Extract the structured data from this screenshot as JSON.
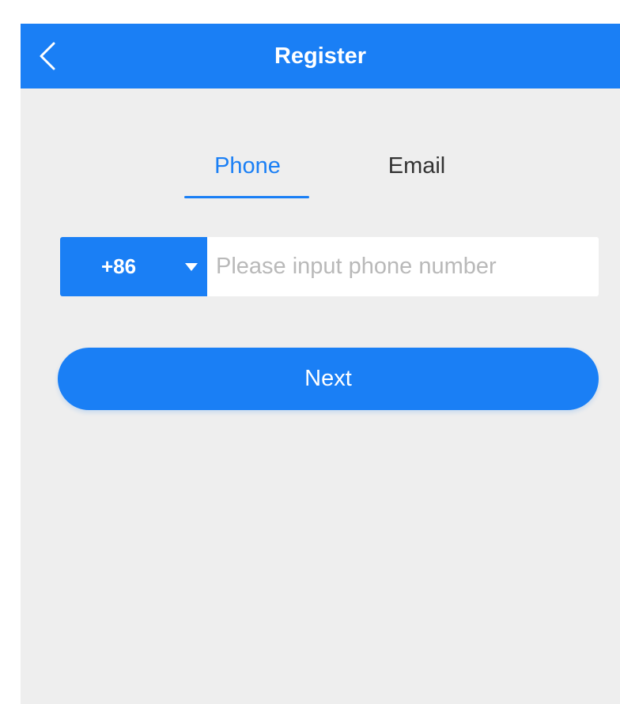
{
  "header": {
    "title": "Register",
    "back_icon": "chevron-left-icon"
  },
  "tabs": [
    {
      "label": "Phone",
      "active": true
    },
    {
      "label": "Email",
      "active": false
    }
  ],
  "phone_form": {
    "country_code": "+86",
    "dropdown_icon": "caret-down-icon",
    "phone_value": "",
    "phone_placeholder": "Please input phone number"
  },
  "actions": {
    "next_label": "Next"
  },
  "colors": {
    "primary": "#1a7ff5",
    "background": "#eeeeee",
    "placeholder": "#b9b9b9",
    "inactive_tab": "#333333"
  }
}
